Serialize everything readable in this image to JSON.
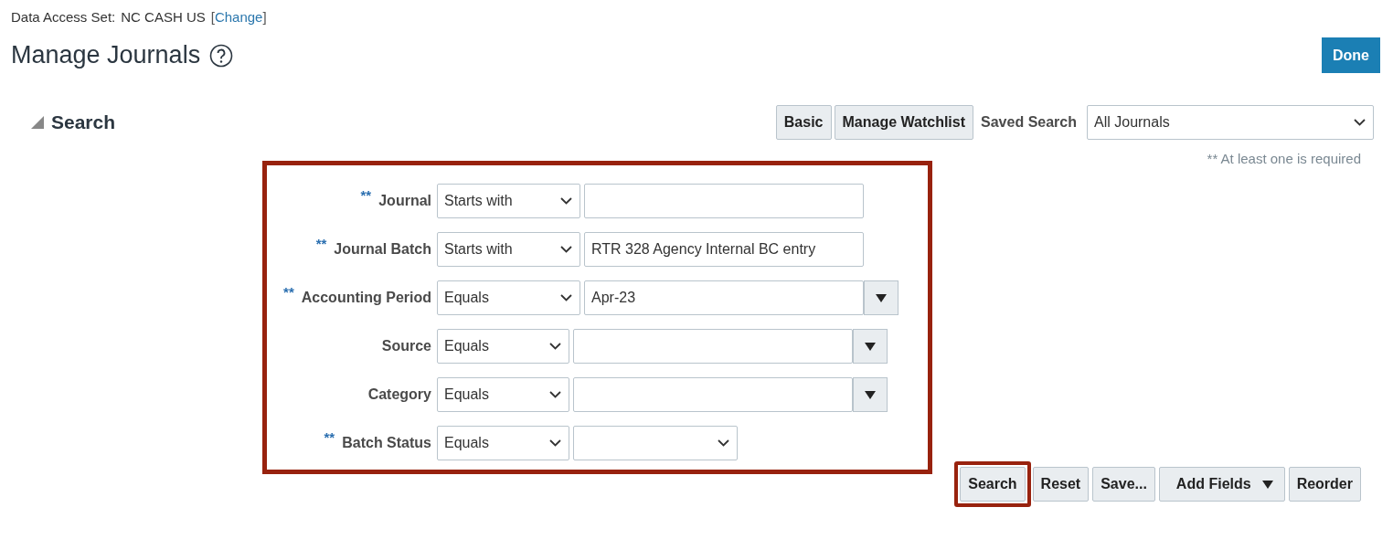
{
  "header": {
    "data_access_label": "Data Access Set:",
    "data_access_value": "NC CASH US",
    "open_bracket": "[",
    "change_link": "Change",
    "close_bracket": "]",
    "title": "Manage Journals",
    "done_button": "Done"
  },
  "search": {
    "title": "Search",
    "expanded": true,
    "basic_button": "Basic",
    "watchlist_button": "Manage Watchlist",
    "saved_search_label": "Saved Search",
    "saved_search_value": "All Journals",
    "required_note": "** At least one is required"
  },
  "form": {
    "highlighted": true,
    "fields": [
      {
        "label": "Journal",
        "required_mark": "**",
        "operator": "Starts with",
        "kind": "text"
      },
      {
        "label": "Journal Batch",
        "required_mark": "**",
        "operator": "Starts with",
        "kind": "text",
        "value": "RTR 328 Agency Internal BC entry"
      },
      {
        "label": "Accounting Period",
        "required_mark": "**",
        "operator": "Equals",
        "kind": "combo",
        "value": "Apr-23"
      },
      {
        "label": "Source",
        "operator": "Equals",
        "kind": "combo"
      },
      {
        "label": "Category",
        "operator": "Equals",
        "kind": "combo"
      },
      {
        "label": "Batch Status",
        "required_mark": "**",
        "operator": "Equals",
        "kind": "select"
      }
    ]
  },
  "buttons": [
    {
      "label": "Search",
      "highlighted": true
    },
    {
      "label": "Reset",
      "highlighted": false
    },
    {
      "label": "Save...",
      "highlighted": false
    },
    {
      "label": "Add Fields",
      "kind": "menu",
      "highlighted": false
    },
    {
      "label": "Reorder",
      "highlighted": false
    }
  ]
}
